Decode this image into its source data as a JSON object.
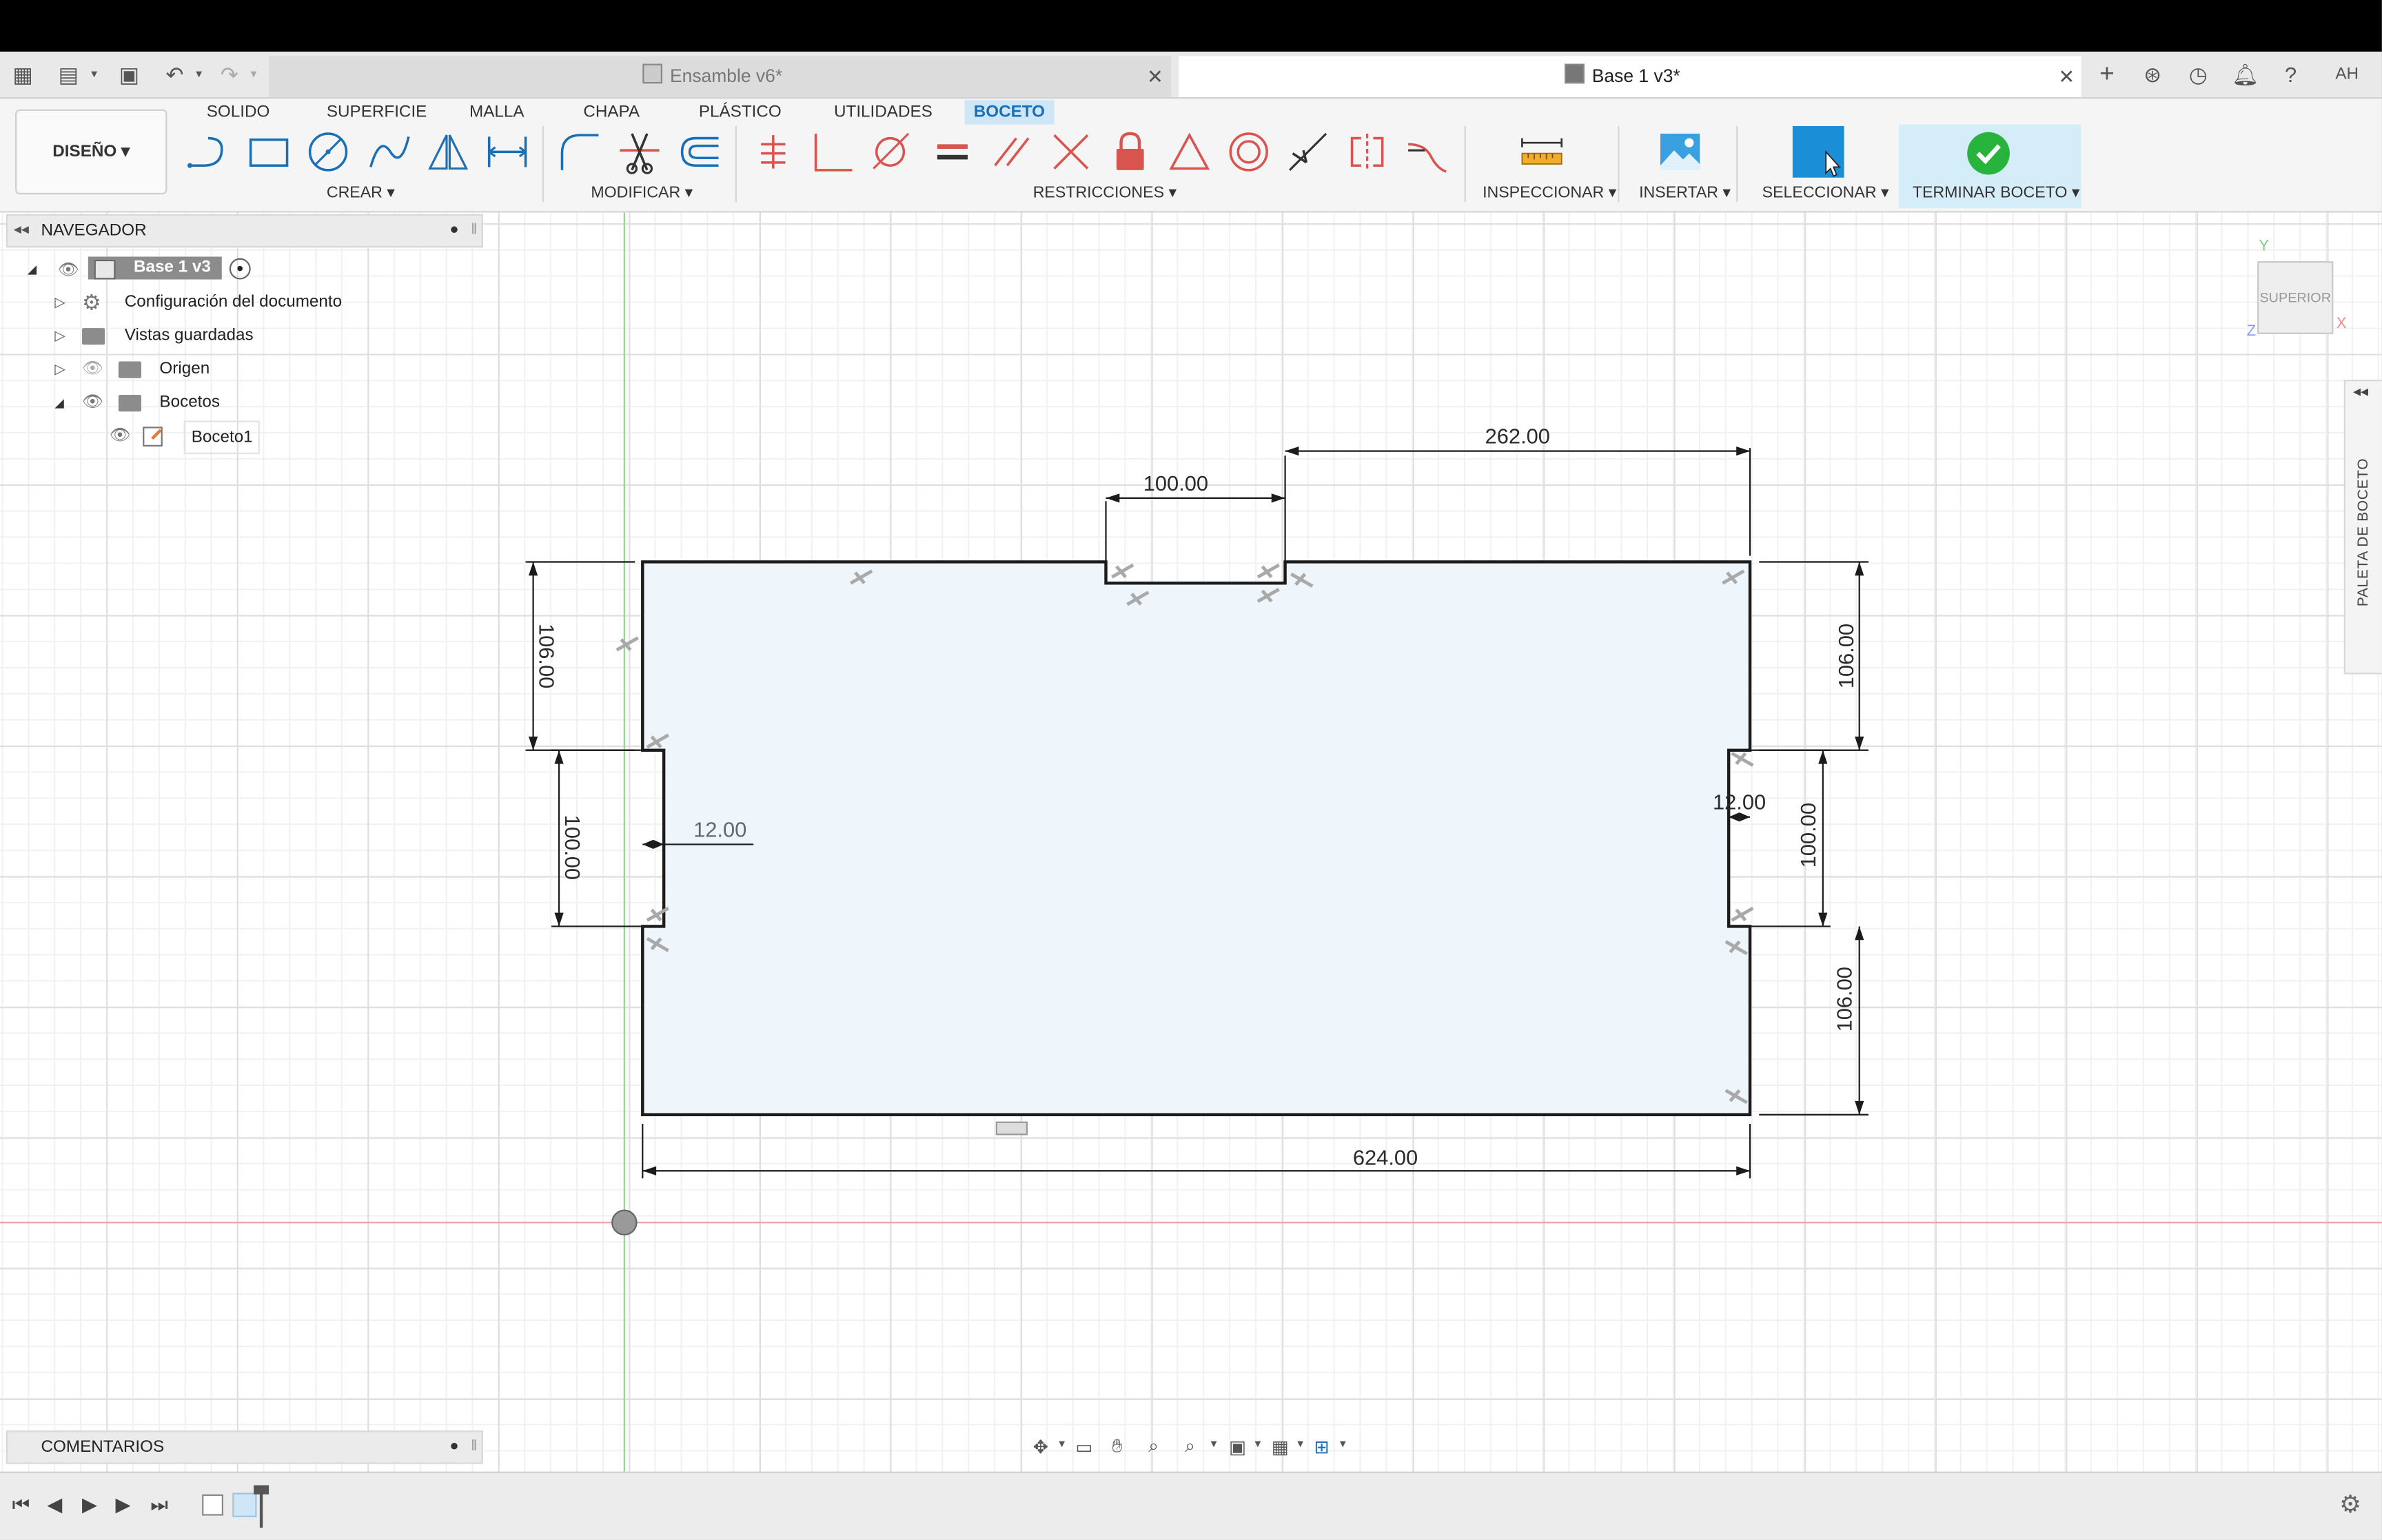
{
  "tabs": [
    {
      "label": "Ensamble v6*",
      "active": false
    },
    {
      "label": "Base 1 v3*",
      "active": true
    }
  ],
  "user_initials": "AH",
  "workspace_tabs": [
    "SOLIDO",
    "SUPERFICIE",
    "MALLA",
    "CHAPA",
    "PLÁSTICO",
    "UTILIDADES",
    "BOCETO"
  ],
  "active_workspace_tab": "BOCETO",
  "design_button": "DISEÑO ▾",
  "groups": {
    "crear": "CREAR ▾",
    "modificar": "MODIFICAR ▾",
    "restricciones": "RESTRICCIONES ▾",
    "inspeccionar": "INSPECCIONAR ▾",
    "insertar": "INSERTAR ▾",
    "seleccionar": "SELECCIONAR ▾",
    "terminar": "TERMINAR BOCETO ▾"
  },
  "navigator": {
    "title": "NAVEGADOR",
    "root": "Base 1 v3",
    "items": [
      {
        "label": "Configuración del documento"
      },
      {
        "label": "Vistas guardadas"
      },
      {
        "label": "Origen"
      },
      {
        "label": "Bocetos"
      },
      {
        "label": "Boceto1"
      }
    ]
  },
  "viewcube_label": "SUPERIOR",
  "axis_labels": {
    "x": "X",
    "y": "Y",
    "z": "Z"
  },
  "palette_label": "PALETA DE BOCETO",
  "comments_label": "COMENTARIOS",
  "dimensions": {
    "top_notch_width": "100.00",
    "top_right": "262.00",
    "left_upper": "106.00",
    "left_notch": "100.00",
    "left_depth": "12.00",
    "right_upper": "106.00",
    "right_notch": "100.00",
    "right_lower": "106.00",
    "right_depth": "12.00",
    "bottom_width": "624.00"
  },
  "colors": {
    "accent": "#1a6fb5",
    "active_tab_bg": "#cfe6f7",
    "finish_bg": "#d5ecf9",
    "finish_check": "#27b33c",
    "sketch_fill": "#eef5fb",
    "axis_green": "#8fd98f",
    "axis_red": "#f0a0a0"
  }
}
